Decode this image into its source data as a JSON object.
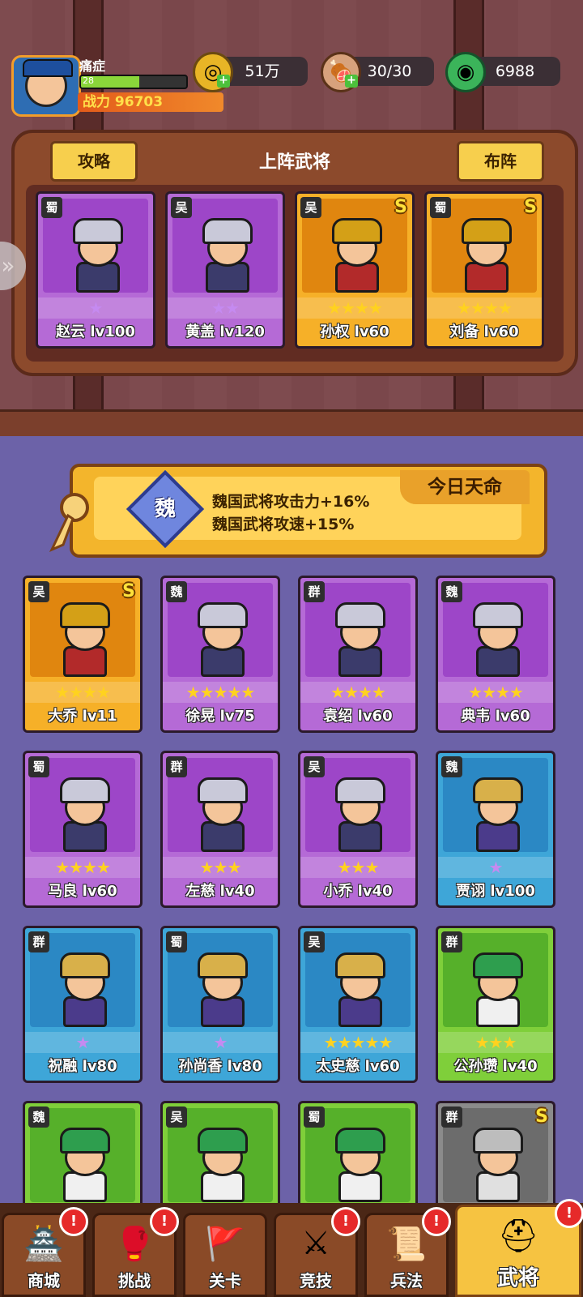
{
  "player": {
    "name": "痛症",
    "level": "28",
    "level_progress": 0.55,
    "power_label": "战力 96703"
  },
  "resources": [
    {
      "icon": "coin-icon",
      "value": "51万"
    },
    {
      "icon": "meat-icon",
      "value": "30/30"
    },
    {
      "icon": "jade-icon",
      "value": "6988"
    }
  ],
  "lineup": {
    "title": "上阵武将",
    "left_button": "攻略",
    "right_button": "布阵",
    "heroes": [
      {
        "faction": "蜀",
        "name": "赵云 lv100",
        "stars": "★",
        "star_color": "purple",
        "rank": "",
        "card": "purple"
      },
      {
        "faction": "吴",
        "name": "黄盖 lv120",
        "stars": "★★",
        "star_color": "purple",
        "rank": "",
        "card": "purple"
      },
      {
        "faction": "吴",
        "name": "孙权 lv60",
        "stars": "★★★★",
        "star_color": "gold",
        "rank": "S",
        "card": "gold"
      },
      {
        "faction": "蜀",
        "name": "刘备 lv60",
        "stars": "★★★★",
        "star_color": "gold",
        "rank": "S",
        "card": "gold"
      }
    ]
  },
  "destiny": {
    "title": "今日天命",
    "badge": "魏",
    "line1": "魏国武将攻击力+16%",
    "line2": "魏国武将攻速+15%"
  },
  "roster": [
    {
      "faction": "吴",
      "name": "大乔 lv11",
      "stars": "★★★★",
      "star_color": "gold",
      "rank": "S",
      "card": "gold"
    },
    {
      "faction": "魏",
      "name": "徐晃 lv75",
      "stars": "★★★★★",
      "star_color": "gold",
      "rank": "",
      "card": "purple"
    },
    {
      "faction": "群",
      "name": "袁绍 lv60",
      "stars": "★★★★",
      "star_color": "gold",
      "rank": "",
      "card": "purple"
    },
    {
      "faction": "魏",
      "name": "典韦 lv60",
      "stars": "★★★★",
      "star_color": "gold",
      "rank": "",
      "card": "purple"
    },
    {
      "faction": "蜀",
      "name": "马良 lv60",
      "stars": "★★★★",
      "star_color": "gold",
      "rank": "",
      "card": "purple"
    },
    {
      "faction": "群",
      "name": "左慈 lv40",
      "stars": "★★★",
      "star_color": "gold",
      "rank": "",
      "card": "purple"
    },
    {
      "faction": "吴",
      "name": "小乔 lv40",
      "stars": "★★★",
      "star_color": "gold",
      "rank": "",
      "card": "purple"
    },
    {
      "faction": "魏",
      "name": "贾诩 lv100",
      "stars": "★",
      "star_color": "purple",
      "rank": "",
      "card": "blue"
    },
    {
      "faction": "群",
      "name": "祝融 lv80",
      "stars": "★",
      "star_color": "purple",
      "rank": "",
      "card": "blue"
    },
    {
      "faction": "蜀",
      "name": "孙尚香 lv80",
      "stars": "★",
      "star_color": "purple",
      "rank": "",
      "card": "blue"
    },
    {
      "faction": "吴",
      "name": "太史慈 lv60",
      "stars": "★★★★★",
      "star_color": "gold",
      "rank": "",
      "card": "blue"
    },
    {
      "faction": "群",
      "name": "公孙瓒 lv40",
      "stars": "★★★",
      "star_color": "gold",
      "rank": "",
      "card": "green"
    },
    {
      "faction": "魏",
      "name": "",
      "stars": "",
      "star_color": "gold",
      "rank": "",
      "card": "green"
    },
    {
      "faction": "吴",
      "name": "",
      "stars": "",
      "star_color": "gold",
      "rank": "",
      "card": "green"
    },
    {
      "faction": "蜀",
      "name": "",
      "stars": "",
      "star_color": "gold",
      "rank": "",
      "card": "green"
    },
    {
      "faction": "群",
      "name": "",
      "stars": "",
      "star_color": "gold",
      "rank": "S",
      "card": "gray"
    }
  ],
  "nav": [
    {
      "label": "商城",
      "icon": "shop-icon",
      "glyph": "🏯",
      "badge": "!",
      "active": false
    },
    {
      "label": "挑战",
      "icon": "challenge-icon",
      "glyph": "🥊",
      "badge": "!",
      "active": false
    },
    {
      "label": "关卡",
      "icon": "stage-flag-icon",
      "glyph": "🚩",
      "badge": "",
      "active": false
    },
    {
      "label": "竞技",
      "icon": "crossed-swords-icon",
      "glyph": "⚔",
      "badge": "!",
      "active": false
    },
    {
      "label": "兵法",
      "icon": "scroll-icon",
      "glyph": "📜",
      "badge": "!",
      "active": false
    },
    {
      "label": "武将",
      "icon": "general-helmet-icon",
      "glyph": "⛑",
      "badge": "!",
      "active": true
    }
  ],
  "colors": {
    "gold_star": "#ffd21f",
    "purple_star": "#c58af0",
    "panel_brown": "#8c4a2c",
    "bottom_bg": "#6c62a8"
  }
}
